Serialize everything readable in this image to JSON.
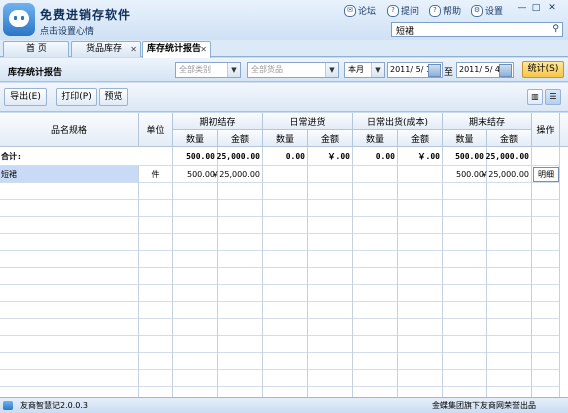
{
  "app": {
    "title": "免费进销存软件",
    "subtitle": "点击设置心情"
  },
  "toplinks": [
    {
      "label": "论坛",
      "icon": "forum-icon"
    },
    {
      "label": "提问",
      "icon": "question-icon"
    },
    {
      "label": "帮助",
      "icon": "help-icon"
    },
    {
      "label": "设置",
      "icon": "gear-icon"
    }
  ],
  "search": {
    "value": "短裙"
  },
  "tabs": [
    {
      "label": "首 页"
    },
    {
      "label": "货品库存"
    },
    {
      "label": "库存统计报告"
    }
  ],
  "filter": {
    "report_title": "库存统计报告",
    "category": "全部类别",
    "goods": "全部货品",
    "period": "本月",
    "date_from": "2011/ 5/ 1",
    "to_label": "至",
    "date_to": "2011/ 5/ 4",
    "stats_button": "统计(S)"
  },
  "toolbar": {
    "export_label": "导出(E)",
    "print_label": "打印(P)",
    "preview_label": "预览"
  },
  "table": {
    "col_name": "品名规格",
    "col_unit": "单位",
    "groups": [
      "期初结存",
      "日常进货",
      "日常出货(成本)",
      "期末结存"
    ],
    "sub_qty": "数量",
    "sub_amount": "金额",
    "col_action": "操作",
    "total": {
      "label": "合计:",
      "cells": [
        "500.00",
        "25,000.00",
        "0.00",
        "￥.00",
        "0.00",
        "￥.00",
        "500.00",
        "25,000.00"
      ]
    },
    "rows": [
      {
        "name": "短裙",
        "unit": "件",
        "cells": [
          "500.00",
          "￥25,000.00",
          "",
          "",
          "",
          "",
          "500.00",
          "￥25,000.00"
        ],
        "action": "明细"
      }
    ]
  },
  "status": {
    "version": "友商智慧记2.0.0.3",
    "company": "金蝶集团旗下友商网荣誉出品"
  },
  "colors": {
    "accent": "#2a76c6",
    "stats_button": "#f6c548",
    "selected_row": "#c9daf6"
  }
}
